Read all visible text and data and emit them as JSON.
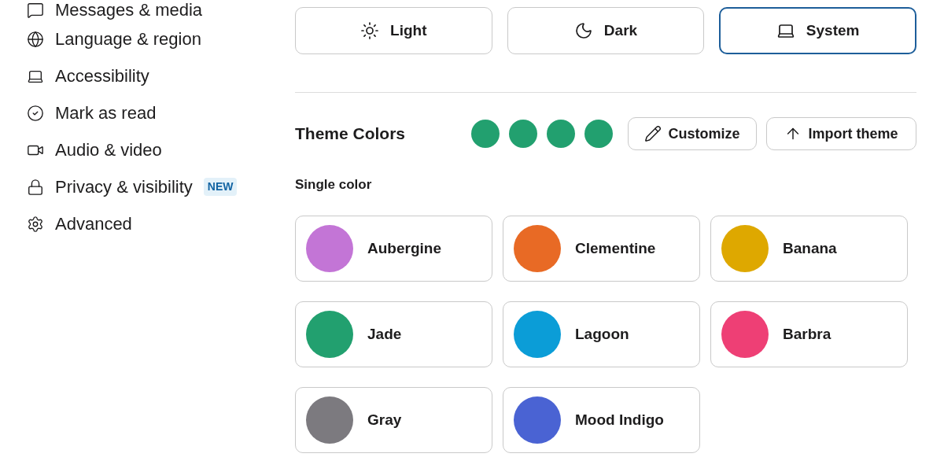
{
  "sidebar": {
    "items": [
      {
        "label": "Messages & media",
        "selected": false
      },
      {
        "label": "Language & region",
        "selected": false
      },
      {
        "label": "Accessibility",
        "selected": false
      },
      {
        "label": "Mark as read",
        "selected": false
      },
      {
        "label": "Audio & video",
        "selected": false
      },
      {
        "label": "Privacy & visibility",
        "selected": false,
        "badge": "NEW"
      },
      {
        "label": "Advanced",
        "selected": false
      }
    ]
  },
  "appearance_modes": [
    {
      "label": "Light",
      "selected": false
    },
    {
      "label": "Dark",
      "selected": false
    },
    {
      "label": "System",
      "selected": true
    }
  ],
  "theme_colors": {
    "title": "Theme Colors",
    "swatches": [
      {
        "color": "#22a06f"
      },
      {
        "color": "#22a06f"
      },
      {
        "color": "#22a06f"
      },
      {
        "color": "#22a06f"
      }
    ],
    "buttons": [
      "Customize",
      "Import theme"
    ]
  },
  "single_color": {
    "title": "Single color",
    "themes": [
      {
        "name": "Aubergine",
        "color": "#c375d6",
        "selected": false
      },
      {
        "name": "Clementine",
        "color": "#e86a25",
        "selected": false
      },
      {
        "name": "Banana",
        "color": "#dea800",
        "selected": false
      },
      {
        "name": "Jade",
        "color": "#22a06f",
        "selected": false
      },
      {
        "name": "Lagoon",
        "color": "#0b9dd7",
        "selected": false
      },
      {
        "name": "Barbra",
        "color": "#ee3f75",
        "selected": false
      },
      {
        "name": "Gray",
        "color": "#7c7a7f",
        "selected": false
      },
      {
        "name": "Mood Indigo",
        "color": "#4a63d3",
        "selected": false
      }
    ]
  }
}
